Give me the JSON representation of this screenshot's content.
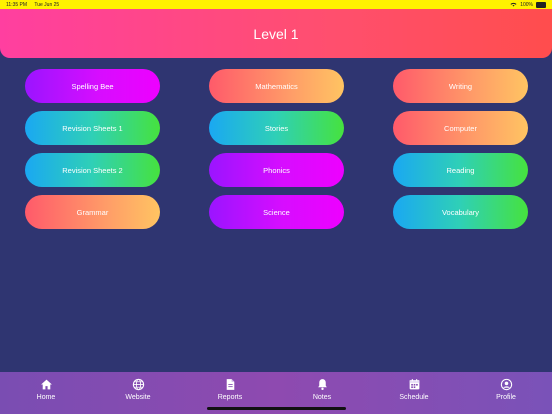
{
  "status": {
    "time": "11:35 PM",
    "date": "Tue Jun 25",
    "battery": "100%"
  },
  "header": {
    "title": "Level 1"
  },
  "subjects": [
    {
      "label": "Spelling Bee",
      "style": "purple"
    },
    {
      "label": "Mathematics",
      "style": "orange"
    },
    {
      "label": "Writing",
      "style": "orange"
    },
    {
      "label": "Revision Sheets 1",
      "style": "green"
    },
    {
      "label": "Stories",
      "style": "green"
    },
    {
      "label": "Computer",
      "style": "orange"
    },
    {
      "label": "Revision Sheets 2",
      "style": "green"
    },
    {
      "label": "Phonics",
      "style": "purple"
    },
    {
      "label": "Reading",
      "style": "green"
    },
    {
      "label": "Grammar",
      "style": "orange"
    },
    {
      "label": "Science",
      "style": "purple"
    },
    {
      "label": "Vocabulary",
      "style": "green"
    }
  ],
  "tabs": [
    {
      "label": "Home",
      "icon": "home-icon"
    },
    {
      "label": "Website",
      "icon": "globe-icon"
    },
    {
      "label": "Reports",
      "icon": "document-icon"
    },
    {
      "label": "Notes",
      "icon": "bell-icon"
    },
    {
      "label": "Schedule",
      "icon": "calendar-icon"
    },
    {
      "label": "Profile",
      "icon": "person-icon"
    }
  ],
  "colors": {
    "background": "#2f3571",
    "status_bar": "#fff200",
    "header_start": "#ff3fa0",
    "header_end": "#ff4d4d",
    "tabbar": "#8248b0"
  }
}
